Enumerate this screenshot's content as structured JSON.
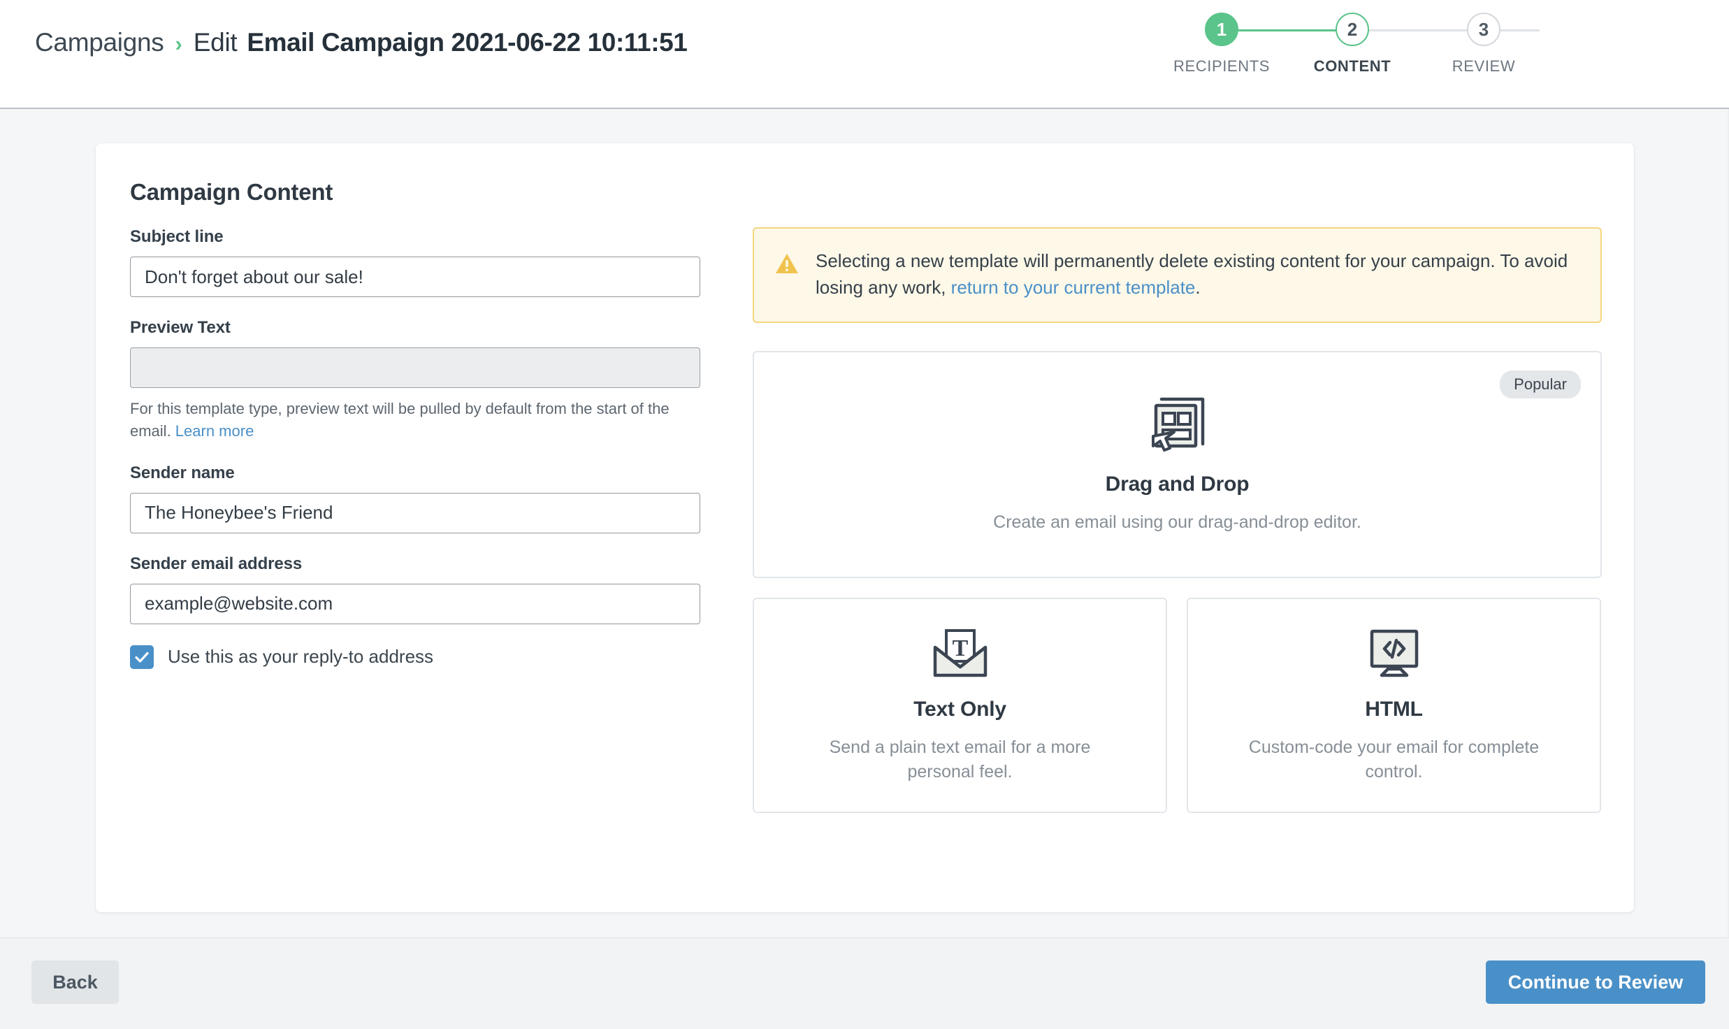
{
  "header": {
    "breadcrumb_root": "Campaigns",
    "breadcrumb_separator": "›",
    "breadcrumb_action": "Edit",
    "breadcrumb_title": "Email Campaign 2021-06-22 10:11:51"
  },
  "stepper": {
    "steps": [
      {
        "number": "1",
        "label": "RECIPIENTS",
        "state": "done"
      },
      {
        "number": "2",
        "label": "CONTENT",
        "state": "current"
      },
      {
        "number": "3",
        "label": "REVIEW",
        "state": "todo"
      }
    ],
    "accent_green": "#5bc48a",
    "inactive_gray": "#d4d8dd"
  },
  "card": {
    "title": "Campaign Content"
  },
  "form": {
    "subject": {
      "label": "Subject line",
      "value": "Don't forget about our sale!",
      "placeholder": ""
    },
    "preview_text": {
      "label": "Preview Text",
      "value": "",
      "placeholder": "",
      "help": "For this template type, preview text will be pulled by default from the start of the email. ",
      "help_link": "Learn more"
    },
    "sender_name": {
      "label": "Sender name",
      "value": "The Honeybee's Friend",
      "placeholder": ""
    },
    "sender_email": {
      "label": "Sender email address",
      "value": "example@website.com",
      "placeholder": ""
    },
    "reply_to": {
      "label": "Use this as your reply-to address",
      "checked": true,
      "accent": "#4a90c8"
    }
  },
  "warning": {
    "icon": "warning-triangle-icon",
    "text_before": "Selecting a new template will permanently delete existing content for your campaign. To avoid losing any work, ",
    "link_text": "return to your current template",
    "text_after": ".",
    "background": "#fdf8e8",
    "border": "#f5d67e",
    "icon_color": "#f0c34e"
  },
  "templates": [
    {
      "id": "drag-and-drop",
      "name": "Drag and Drop",
      "description": "Create an email using our drag-and-drop editor.",
      "badge": "Popular",
      "icon": "drag-and-drop-icon"
    },
    {
      "id": "text-only",
      "name": "Text Only",
      "description": "Send a plain text email for a more personal feel.",
      "badge": "",
      "icon": "envelope-text-icon"
    },
    {
      "id": "html",
      "name": "HTML",
      "description": "Custom-code your email for complete control.",
      "badge": "",
      "icon": "monitor-code-icon"
    }
  ],
  "footer": {
    "back_label": "Back",
    "continue_label": "Continue to Review",
    "primary_color": "#4a90c8"
  }
}
